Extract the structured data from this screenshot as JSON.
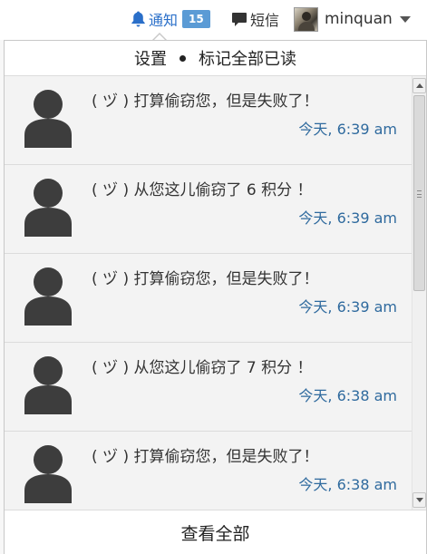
{
  "nav": {
    "notify_label": "通知",
    "notify_count": "15",
    "messages_label": "短信",
    "username": "minquan"
  },
  "dropdown": {
    "settings_label": "设置",
    "mark_all_read_label": "标记全部已读",
    "view_all_label": "查看全部",
    "items": [
      {
        "text": "( ヅ ) 打算偷窃您，但是失败了！",
        "time": "今天, 6:39 am"
      },
      {
        "text": "( ヅ ) 从您这儿偷窃了 6 积分 ！",
        "time": "今天, 6:39 am"
      },
      {
        "text": "( ヅ ) 打算偷窃您，但是失败了！",
        "time": "今天, 6:39 am"
      },
      {
        "text": "( ヅ ) 从您这儿偷窃了 7 积分 ！",
        "time": "今天, 6:38 am"
      },
      {
        "text": "( ヅ ) 打算偷窃您，但是失败了！",
        "time": "今天, 6:38 am"
      }
    ]
  },
  "icons": {
    "notify": "bell-icon",
    "messages": "speech-bubble-icon",
    "user": "avatar",
    "item": "person-icon"
  },
  "colors": {
    "link_blue": "#2a6fc9",
    "badge_blue": "#5b9bd5",
    "time_blue": "#2f6a9e",
    "icon_dark": "#3d3d3d"
  }
}
